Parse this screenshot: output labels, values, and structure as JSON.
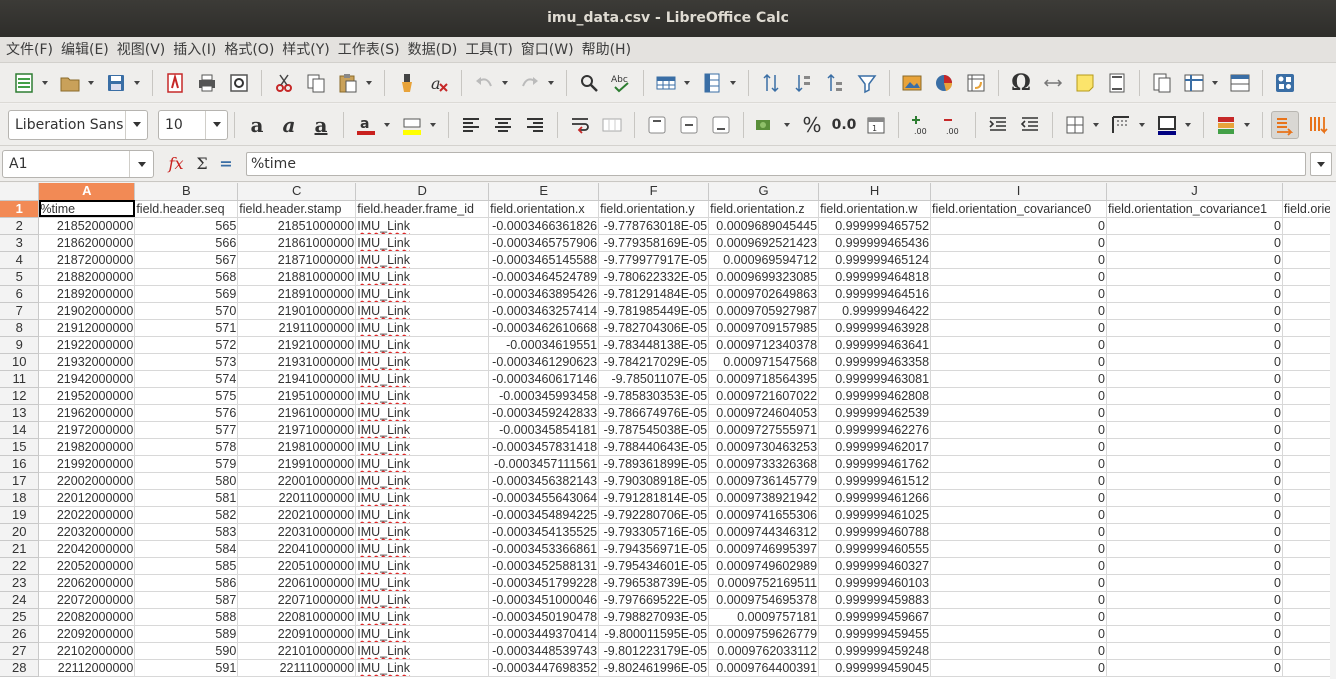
{
  "window": {
    "title": "imu_data.csv - LibreOffice Calc"
  },
  "menu": [
    "文件(F)",
    "编辑(E)",
    "视图(V)",
    "插入(I)",
    "格式(O)",
    "样式(Y)",
    "工作表(S)",
    "数据(D)",
    "工具(T)",
    "窗口(W)",
    "帮助(H)"
  ],
  "format_toolbar": {
    "font_name": "Liberation Sans",
    "font_size": "10",
    "percent_label": "%",
    "decimal_label": "0.0"
  },
  "formula_bar": {
    "cell_ref": "A1",
    "content": "%time",
    "fx_label": "fx",
    "sum_label": "Σ",
    "equals_label": "="
  },
  "sheet": {
    "columns": [
      "A",
      "B",
      "C",
      "D",
      "E",
      "F",
      "G",
      "H",
      "I",
      "J",
      ""
    ],
    "header_row": [
      "%time",
      "field.header.seq",
      "field.header.stamp",
      "field.header.frame_id",
      "field.orientation.x",
      "field.orientation.y",
      "field.orientation.z",
      "field.orientation.w",
      "field.orientation_covariance0",
      "field.orientation_covariance1",
      "field.orie"
    ],
    "rows": [
      [
        "21852000000",
        "565",
        "21851000000",
        "IMU_Link",
        "-0.0003466361826",
        "-9.778763018E-05",
        "0.0009689045445",
        "0.999999465752",
        "0",
        "0"
      ],
      [
        "21862000000",
        "566",
        "21861000000",
        "IMU_Link",
        "-0.0003465757906",
        "-9.779358169E-05",
        "0.0009692521423",
        "0.999999465436",
        "0",
        "0"
      ],
      [
        "21872000000",
        "567",
        "21871000000",
        "IMU_Link",
        "-0.0003465145588",
        "-9.779977917E-05",
        "0.000969594712",
        "0.999999465124",
        "0",
        "0"
      ],
      [
        "21882000000",
        "568",
        "21881000000",
        "IMU_Link",
        "-0.0003464524789",
        "-9.780622332E-05",
        "0.0009699323085",
        "0.999999464818",
        "0",
        "0"
      ],
      [
        "21892000000",
        "569",
        "21891000000",
        "IMU_Link",
        "-0.0003463895426",
        "-9.781291484E-05",
        "0.0009702649863",
        "0.999999464516",
        "0",
        "0"
      ],
      [
        "21902000000",
        "570",
        "21901000000",
        "IMU_Link",
        "-0.0003463257414",
        "-9.781985449E-05",
        "0.0009705927987",
        "0.99999946422",
        "0",
        "0"
      ],
      [
        "21912000000",
        "571",
        "21911000000",
        "IMU_Link",
        "-0.0003462610668",
        "-9.782704306E-05",
        "0.0009709157985",
        "0.999999463928",
        "0",
        "0"
      ],
      [
        "21922000000",
        "572",
        "21921000000",
        "IMU_Link",
        "-0.00034619551",
        "-9.783448138E-05",
        "0.0009712340378",
        "0.999999463641",
        "0",
        "0"
      ],
      [
        "21932000000",
        "573",
        "21931000000",
        "IMU_Link",
        "-0.0003461290623",
        "-9.784217029E-05",
        "0.000971547568",
        "0.999999463358",
        "0",
        "0"
      ],
      [
        "21942000000",
        "574",
        "21941000000",
        "IMU_Link",
        "-0.0003460617146",
        "-9.78501107E-05",
        "0.0009718564395",
        "0.999999463081",
        "0",
        "0"
      ],
      [
        "21952000000",
        "575",
        "21951000000",
        "IMU_Link",
        "-0.000345993458",
        "-9.785830353E-05",
        "0.0009721607022",
        "0.999999462808",
        "0",
        "0"
      ],
      [
        "21962000000",
        "576",
        "21961000000",
        "IMU_Link",
        "-0.0003459242833",
        "-9.786674976E-05",
        "0.0009724604053",
        "0.999999462539",
        "0",
        "0"
      ],
      [
        "21972000000",
        "577",
        "21971000000",
        "IMU_Link",
        "-0.000345854181",
        "-9.787545038E-05",
        "0.0009727555971",
        "0.999999462276",
        "0",
        "0"
      ],
      [
        "21982000000",
        "578",
        "21981000000",
        "IMU_Link",
        "-0.0003457831418",
        "-9.788440643E-05",
        "0.0009730463253",
        "0.999999462017",
        "0",
        "0"
      ],
      [
        "21992000000",
        "579",
        "21991000000",
        "IMU_Link",
        "-0.0003457111561",
        "-9.789361899E-05",
        "0.0009733326368",
        "0.999999461762",
        "0",
        "0"
      ],
      [
        "22002000000",
        "580",
        "22001000000",
        "IMU_Link",
        "-0.0003456382143",
        "-9.790308918E-05",
        "0.0009736145779",
        "0.999999461512",
        "0",
        "0"
      ],
      [
        "22012000000",
        "581",
        "22011000000",
        "IMU_Link",
        "-0.0003455643064",
        "-9.791281814E-05",
        "0.0009738921942",
        "0.999999461266",
        "0",
        "0"
      ],
      [
        "22022000000",
        "582",
        "22021000000",
        "IMU_Link",
        "-0.0003454894225",
        "-9.792280706E-05",
        "0.0009741655306",
        "0.999999461025",
        "0",
        "0"
      ],
      [
        "22032000000",
        "583",
        "22031000000",
        "IMU_Link",
        "-0.0003454135525",
        "-9.793305716E-05",
        "0.0009744346312",
        "0.999999460788",
        "0",
        "0"
      ],
      [
        "22042000000",
        "584",
        "22041000000",
        "IMU_Link",
        "-0.0003453366861",
        "-9.794356971E-05",
        "0.0009746995397",
        "0.999999460555",
        "0",
        "0"
      ],
      [
        "22052000000",
        "585",
        "22051000000",
        "IMU_Link",
        "-0.0003452588131",
        "-9.795434601E-05",
        "0.0009749602989",
        "0.999999460327",
        "0",
        "0"
      ],
      [
        "22062000000",
        "586",
        "22061000000",
        "IMU_Link",
        "-0.0003451799228",
        "-9.796538739E-05",
        "0.0009752169511",
        "0.999999460103",
        "0",
        "0"
      ],
      [
        "22072000000",
        "587",
        "22071000000",
        "IMU_Link",
        "-0.0003451000046",
        "-9.797669522E-05",
        "0.0009754695378",
        "0.999999459883",
        "0",
        "0"
      ],
      [
        "22082000000",
        "588",
        "22081000000",
        "IMU_Link",
        "-0.0003450190478",
        "-9.798827093E-05",
        "0.0009757181",
        "0.999999459667",
        "0",
        "0"
      ],
      [
        "22092000000",
        "589",
        "22091000000",
        "IMU_Link",
        "-0.0003449370414",
        "-9.800011595E-05",
        "0.0009759626779",
        "0.999999459455",
        "0",
        "0"
      ],
      [
        "22102000000",
        "590",
        "22101000000",
        "IMU_Link",
        "-0.0003448539743",
        "-9.801223179E-05",
        "0.0009762033112",
        "0.999999459248",
        "0",
        "0"
      ],
      [
        "22112000000",
        "591",
        "22111000000",
        "IMU_Link",
        "-0.0003447698352",
        "-9.802461996E-05",
        "0.0009764400391",
        "0.999999459045",
        "0",
        "0"
      ]
    ]
  }
}
